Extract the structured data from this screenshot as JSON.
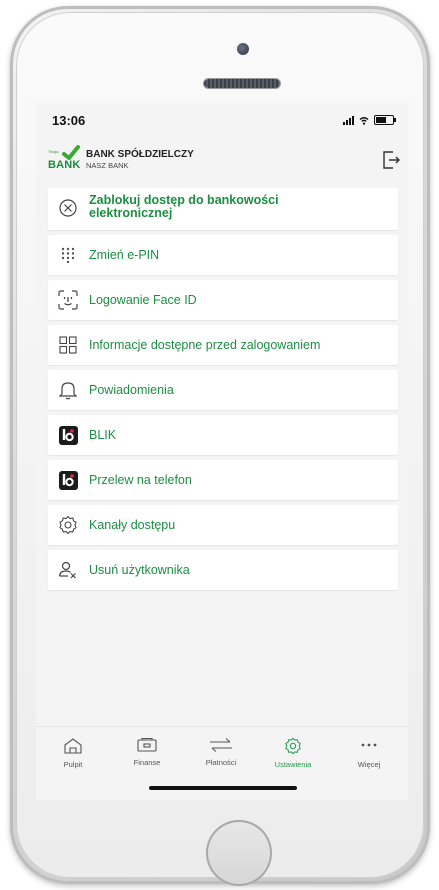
{
  "status": {
    "time": "13:06"
  },
  "header": {
    "logo_small": "Twoja",
    "logo_text": "BANK",
    "bank_name": "BANK SPÓŁDZIELCZY",
    "bank_subtitle": "NASZ BANK"
  },
  "menu": {
    "items": [
      {
        "label": "Zablokuj dostęp do bankowości elektronicznej",
        "icon": "block-icon"
      },
      {
        "label": "Zmień e-PIN",
        "icon": "keypad-icon"
      },
      {
        "label": "Logowanie Face ID",
        "icon": "face-id-icon"
      },
      {
        "label": "Informacje dostępne przed zalogowaniem",
        "icon": "grid-icon"
      },
      {
        "label": "Powiadomienia",
        "icon": "bell-icon"
      },
      {
        "label": "BLIK",
        "icon": "blik-icon"
      },
      {
        "label": "Przelew na telefon",
        "icon": "blik-phone-icon"
      },
      {
        "label": "Kanały dostępu",
        "icon": "gear-icon"
      },
      {
        "label": "Usuń użytkownika",
        "icon": "remove-user-icon"
      }
    ]
  },
  "tabs": [
    {
      "label": "Pulpit",
      "icon": "home-icon"
    },
    {
      "label": "Finanse",
      "icon": "wallet-icon"
    },
    {
      "label": "Płatności",
      "icon": "transfer-icon"
    },
    {
      "label": "Ustawienia",
      "icon": "gear-icon",
      "active": true
    },
    {
      "label": "Więcej",
      "icon": "more-icon"
    }
  ],
  "colors": {
    "accent": "#1d8e43",
    "background": "#f3f4f3"
  }
}
